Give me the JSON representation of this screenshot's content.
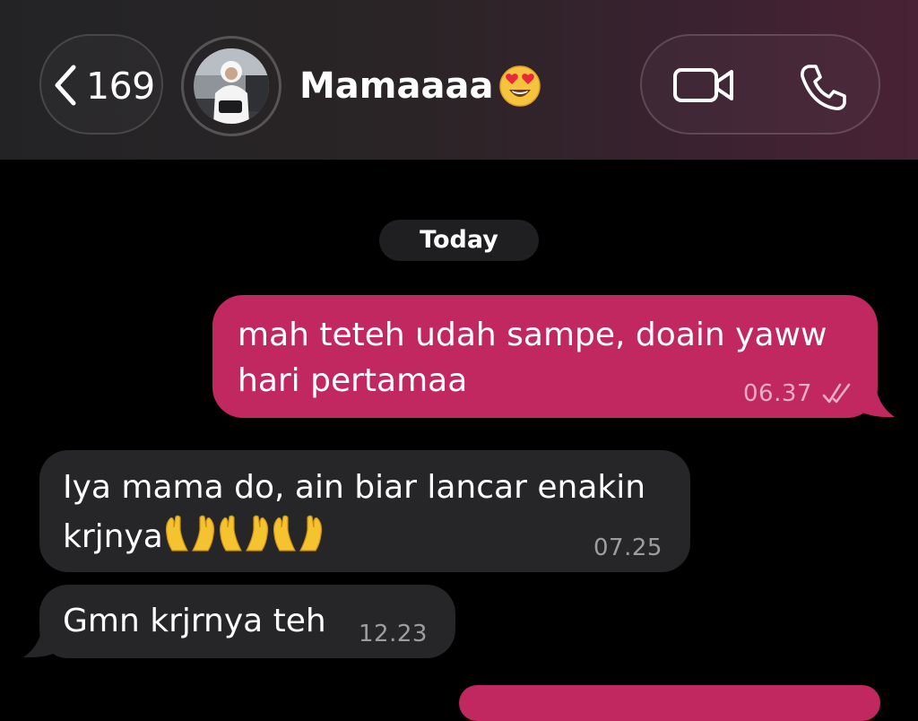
{
  "header": {
    "back_count": "169",
    "contact_name": "Mamaaaa",
    "icons": {
      "back": "chevron-left-icon",
      "avatar": "contact-avatar",
      "name_emoji": "heart-eyes-emoji",
      "video": "video-camera-icon",
      "phone": "phone-icon"
    }
  },
  "chat": {
    "date_label": "Today",
    "messages": [
      {
        "direction": "outgoing",
        "lines": [
          "mah teteh udah sampe, doain yaww",
          "hari pertamaa"
        ],
        "time": "06.37",
        "status": "read-double-check"
      },
      {
        "direction": "incoming",
        "lines": [
          "Iya mama do, ain biar lancar enakin",
          "krjnya"
        ],
        "emoji": "raising-hands-x3",
        "time": "07.25"
      },
      {
        "direction": "incoming",
        "lines": [
          "Gmn krjrnya teh"
        ],
        "time": "12.23"
      }
    ]
  },
  "colors": {
    "outgoing_bubble": "#c0285f",
    "incoming_bubble": "#262628",
    "background": "#000000",
    "date_pill": "#1f1f21"
  }
}
